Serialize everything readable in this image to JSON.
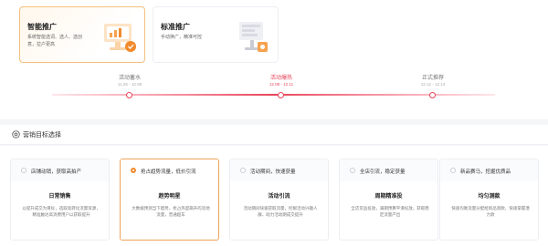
{
  "plans": [
    {
      "title": "智能推广",
      "desc": "系统智能选词、选人、选创意，拉户更高",
      "selected": true
    },
    {
      "title": "标准推广",
      "desc": "手动换广，精准可控",
      "selected": false
    }
  ],
  "timeline": [
    {
      "label": "活动蓄水",
      "dates": "11.25 - 12.08",
      "active": false
    },
    {
      "label": "活动爆热",
      "dates": "12.09 - 12.11",
      "active": true
    },
    {
      "label": "正式推荐",
      "dates": "12.12 - 12.14",
      "active": false
    }
  ],
  "section": {
    "title": "营销目标选择"
  },
  "goals": [
    {
      "option": "店铺动销，获取高拍产",
      "name": "日常销售",
      "desc": "以提升成交为目标，选取高转化流量资源，精准触达高消费用户以获取提升",
      "selected": false
    },
    {
      "option": "抢占趋势流量，低价引流",
      "name": "趋势明星",
      "desc": "大数据预测当下趋势，抢占热度飙升的流地流量，普通超车",
      "selected": true
    },
    {
      "option": "活动期间，快速获量",
      "name": "活动引流",
      "desc": "活动期间快速获取流量，挖掘活动兴趣人群，助力活动期成交提升",
      "selected": false
    },
    {
      "option": "全店引流，稳定获量",
      "name": "周期精准投",
      "desc": "全店货品投放，满期预算平滑投放，获取稳定流量产出",
      "selected": false
    },
    {
      "option": "新品赛马，挖掘优质品",
      "name": "均匀测款",
      "desc": "快速均衡流量分配给新品测款，快速掌握潜力款",
      "selected": false
    }
  ],
  "colors": {
    "accent_orange": "#f28a2d",
    "accent_red": "#e8455a"
  }
}
